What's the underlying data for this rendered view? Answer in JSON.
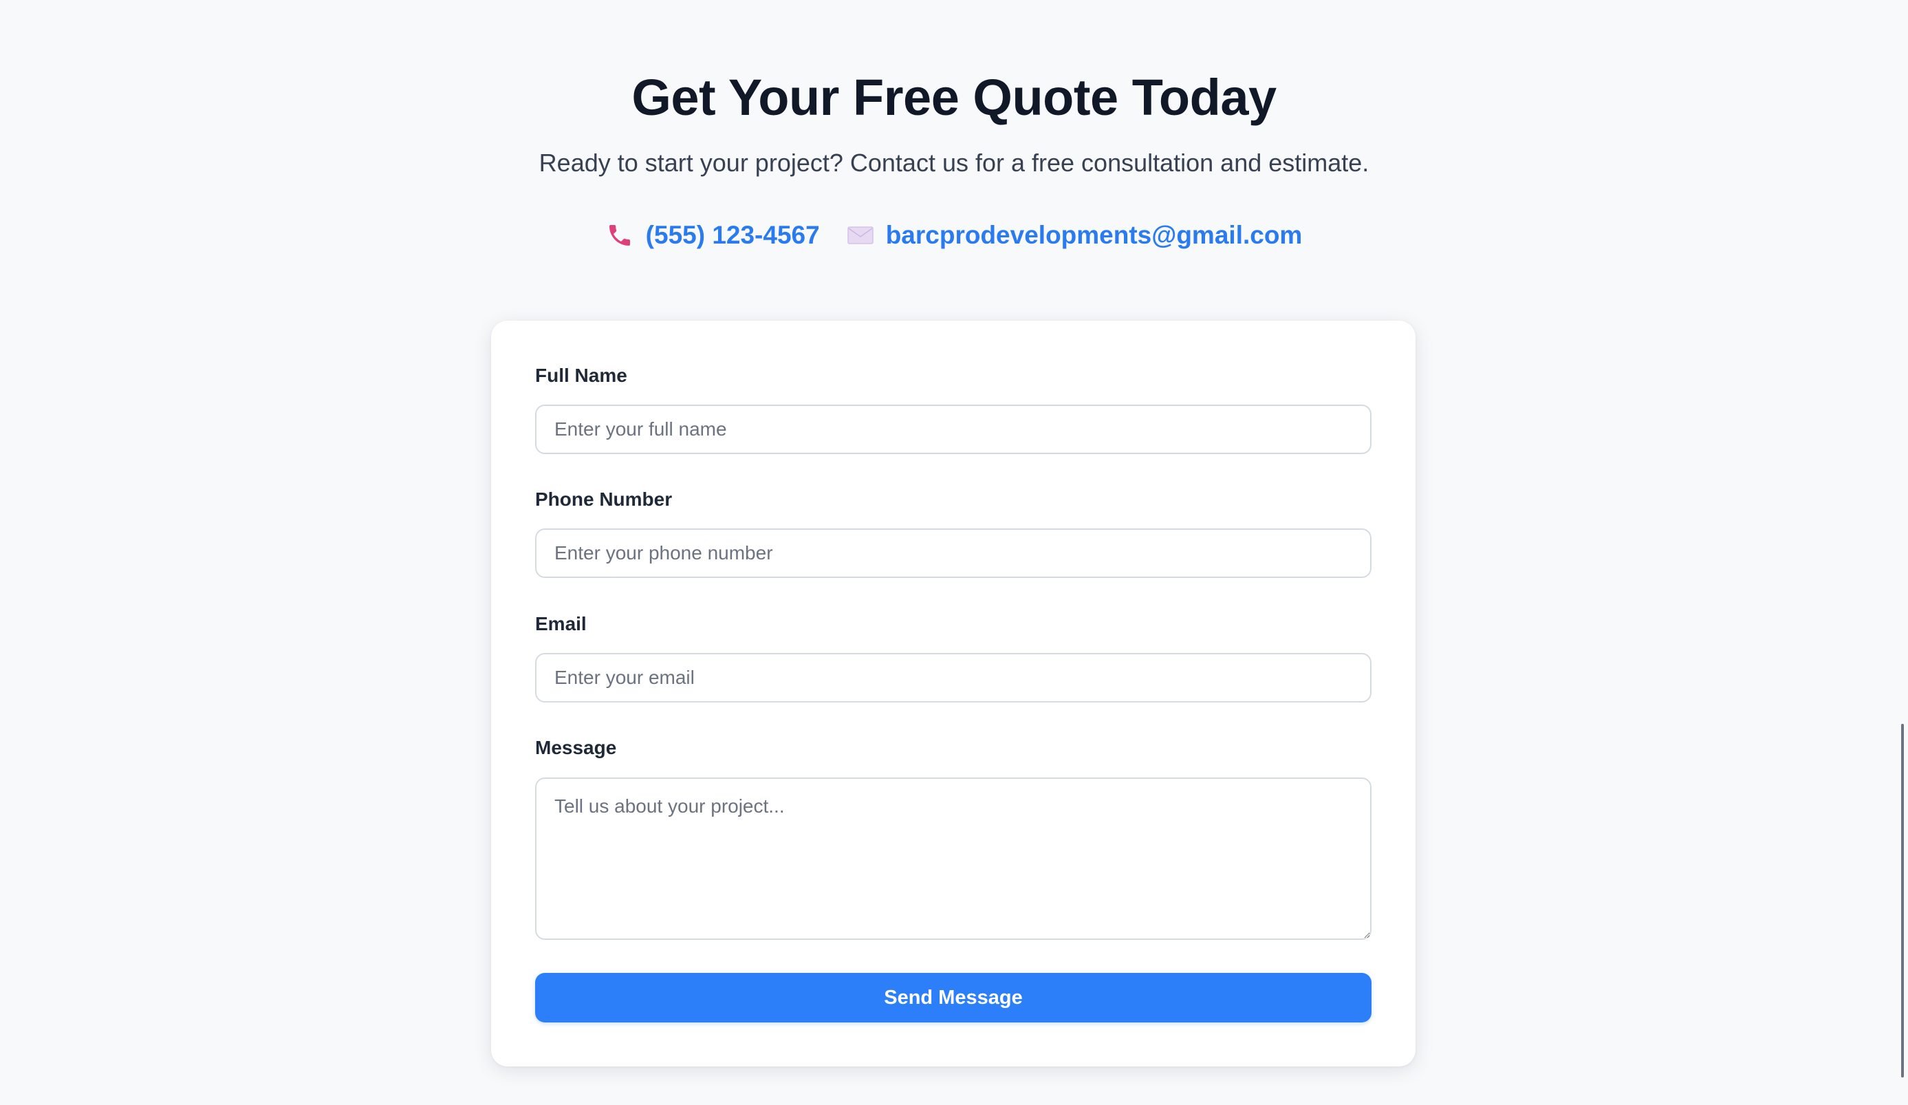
{
  "header": {
    "title": "Get Your Free Quote Today",
    "subtitle": "Ready to start your project? Contact us for a free consultation and estimate."
  },
  "contact": {
    "phone": {
      "icon": "phone-icon",
      "text": "(555) 123-4567"
    },
    "email": {
      "icon": "envelope-icon",
      "text": "barcprodevelopments@gmail.com"
    }
  },
  "form": {
    "full_name": {
      "label": "Full Name",
      "placeholder": "Enter your full name",
      "value": ""
    },
    "phone": {
      "label": "Phone Number",
      "placeholder": "Enter your phone number",
      "value": ""
    },
    "email": {
      "label": "Email",
      "placeholder": "Enter your email",
      "value": ""
    },
    "message": {
      "label": "Message",
      "placeholder": "Tell us about your project...",
      "value": ""
    },
    "submit_label": "Send Message"
  },
  "colors": {
    "accent": "#2d7ff9",
    "link": "#2b7bf0",
    "phone_icon": "#e0407a",
    "background": "#f8f9fb"
  }
}
